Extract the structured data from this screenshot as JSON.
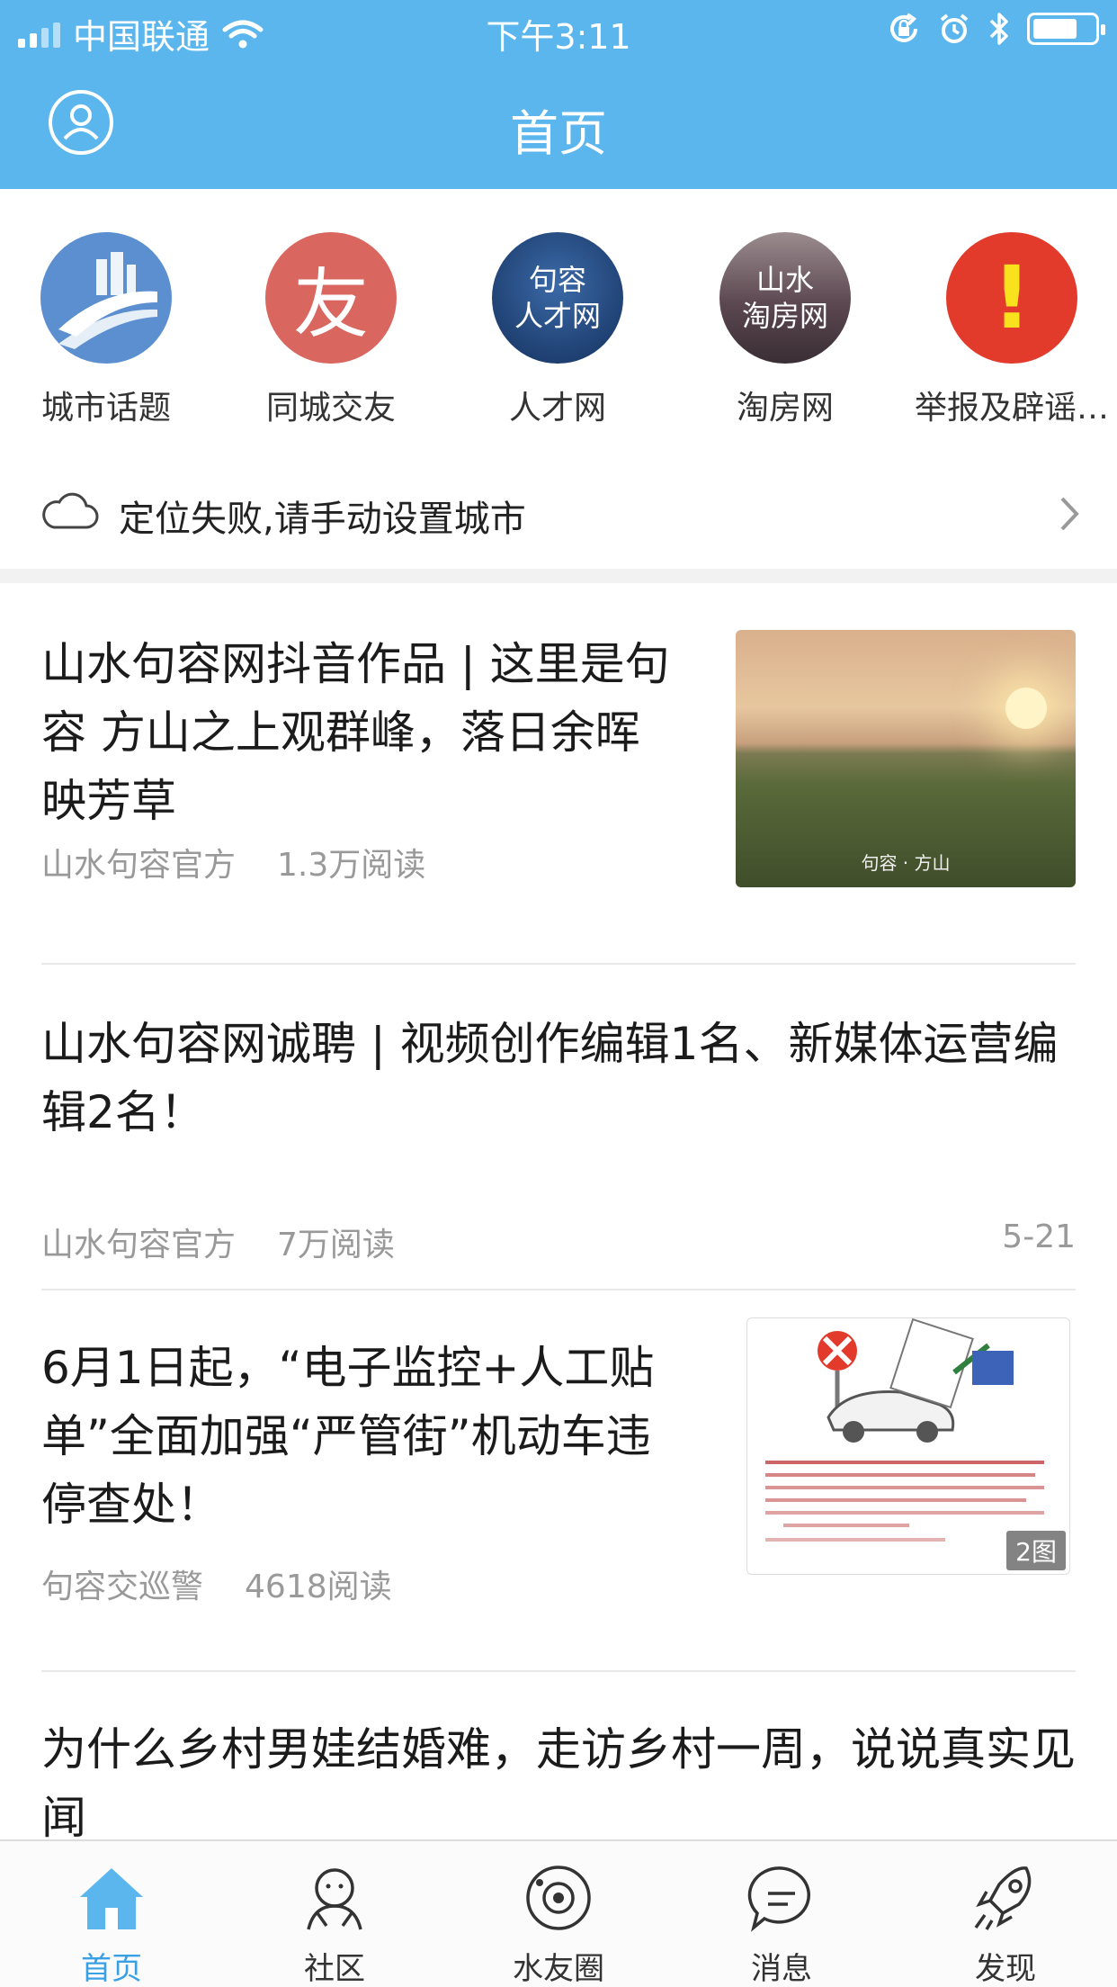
{
  "status_bar": {
    "carrier": "中国联通",
    "time": "下午3:11"
  },
  "navbar": {
    "title": "首页"
  },
  "quick_entries": [
    {
      "label": "城市话题",
      "icon": "city-road-icon",
      "color": "#5b8fd0"
    },
    {
      "label": "同城交友",
      "icon_text": "友",
      "color": "#d9675f"
    },
    {
      "label": "人才网",
      "icon_text": "句容 人才网",
      "color": "#1f3f73"
    },
    {
      "label": "淘房网",
      "icon_text": "山水 淘房网",
      "color": "#6b5a64"
    },
    {
      "label": "举报及辟谣…",
      "icon_text": "!",
      "color": "#e23a2b"
    }
  ],
  "location": {
    "text": "定位失败,请手动设置城市"
  },
  "articles": [
    {
      "title": "山水句容网抖音作品 | 这里是句容 方山之上观群峰，落日余晖映芳草",
      "source": "山水句容官方",
      "reads": "1.3万阅读",
      "thumb_caption": "句容 · 方山"
    },
    {
      "title": "山水句容网诚聘 | 视频创作编辑1名、新媒体运营编辑2名！",
      "source": "山水句容官方",
      "reads": "7万阅读",
      "date": "5-21"
    },
    {
      "title": "6月1日起，“电子监控+人工贴单”全面加强“严管街”机动车违停查处！",
      "source": "句容交巡警",
      "reads": "4618阅读",
      "badge": "2图"
    },
    {
      "title": "为什么乡村男娃结婚难，走访乡村一周，说说真实见闻"
    }
  ],
  "tabs": [
    {
      "label": "首页",
      "icon": "home-icon",
      "active": true
    },
    {
      "label": "社区",
      "icon": "community-icon"
    },
    {
      "label": "水友圈",
      "icon": "planet-icon"
    },
    {
      "label": "消息",
      "icon": "message-icon"
    },
    {
      "label": "发现",
      "icon": "rocket-icon"
    }
  ],
  "colors": {
    "accent": "#5cb6ee",
    "tab_active": "#3aa0e4"
  }
}
